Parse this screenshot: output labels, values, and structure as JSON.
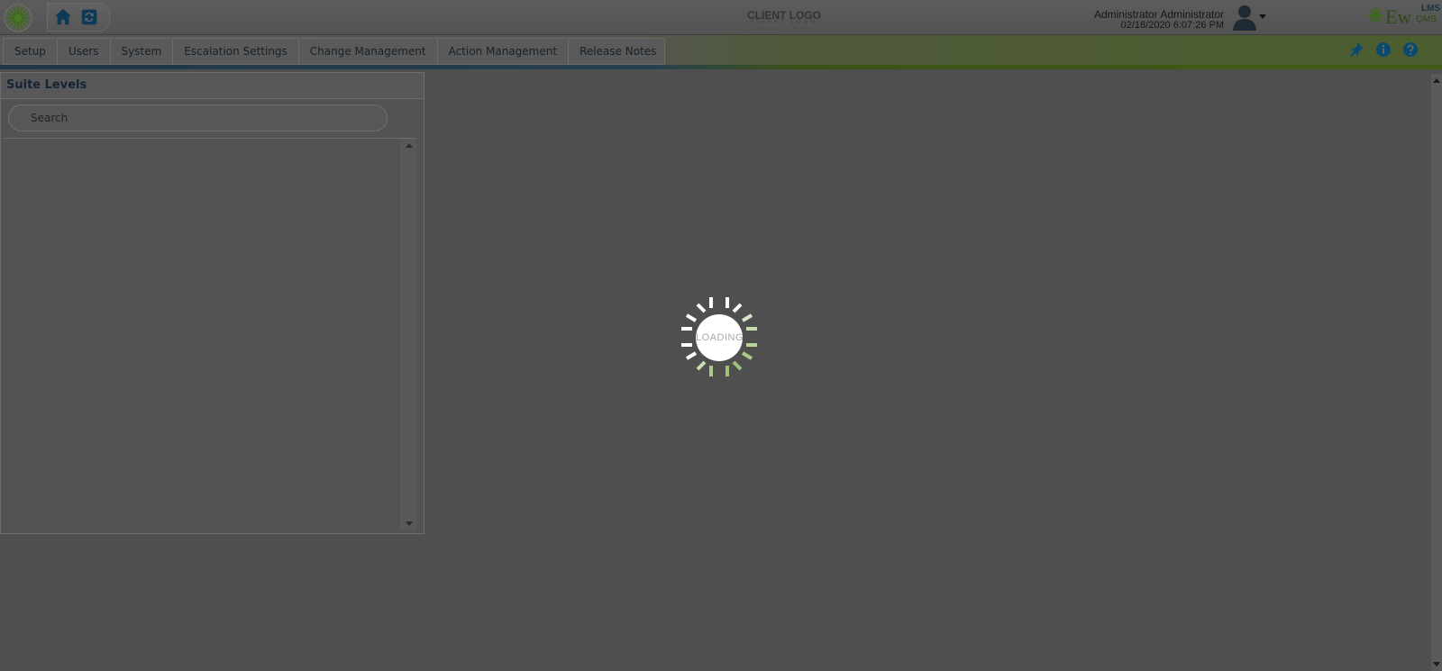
{
  "header": {
    "client_logo": "CLIENT LOGO",
    "client_logo_sub": "CLIENT LOGO",
    "user_name": "Administrator Administrator",
    "datetime": "02/18/2020 6:07:26 PM",
    "brand_ew": "Ew",
    "brand_lms": "LMS",
    "brand_qms": "QMS"
  },
  "nav": {
    "items": [
      {
        "label": "Setup"
      },
      {
        "label": "Users"
      },
      {
        "label": "System"
      },
      {
        "label": "Escalation Settings"
      },
      {
        "label": "Change Management"
      },
      {
        "label": "Action Management"
      },
      {
        "label": "Release Notes"
      }
    ],
    "icons": [
      "pin-icon",
      "info-icon",
      "help-icon"
    ]
  },
  "panel": {
    "title": "Suite Levels",
    "search_placeholder": "Search"
  },
  "loader": {
    "text": "LOADING"
  },
  "colors": {
    "overlay": "#4f4f4f",
    "accent_green": "#9cc27a",
    "accent_blue": "#0a5b8f"
  }
}
